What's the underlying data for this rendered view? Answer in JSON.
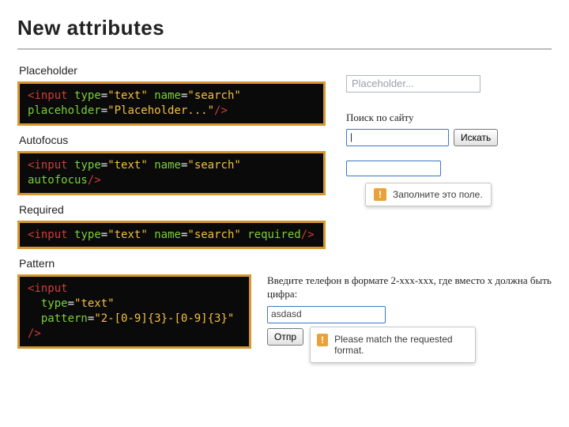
{
  "title": "New attributes",
  "sections": {
    "placeholder": {
      "label": "Placeholder",
      "code": {
        "lt1": "<",
        "tag1": "input",
        "sp1": " ",
        "attr1": "type",
        "eq1": "=",
        "q1": "\"",
        "val1": "text",
        "q2": "\"",
        "sp2": " ",
        "attr2": "name",
        "eq2": "=",
        "q3": "\"",
        "val2": "search",
        "q4": "\"",
        "br": "",
        "attr3": "placeholder",
        "eq3": "=",
        "q5": "\"",
        "val3": "Placeholder...",
        "q6": "\"",
        "slash": "/>",
        "close": ""
      },
      "demo_placeholder": "Placeholder..."
    },
    "autofocus": {
      "label": "Autofocus",
      "code": {
        "lt": "<",
        "tag": "input",
        "sp1": " ",
        "attr1": "type",
        "eq1": "=",
        "q1": "\"",
        "val1": "text",
        "q2": "\"",
        "sp2": " ",
        "attr2": "name",
        "eq2": "=",
        "q3": "\"",
        "val2": "search",
        "q4": "\"",
        "sp3": " ",
        "attr3": "autofocus",
        "slash": "/>"
      },
      "demo_label": "Поиск по сайту",
      "demo_caret": "|",
      "demo_button": "Искать"
    },
    "required": {
      "label": "Required",
      "code": {
        "lt": "<",
        "tag": "input",
        "sp1": " ",
        "attr1": "type",
        "eq1": "=",
        "q1": "\"",
        "val1": "text",
        "q2": "\"",
        "sp2": " ",
        "attr2": "name",
        "eq2": "=",
        "q3": "\"",
        "val2": "search",
        "q4": "\"",
        "sp3": " ",
        "attr3": "required",
        "slash": "/>"
      },
      "tooltip_icon": "!",
      "tooltip_text": "Заполните это поле."
    },
    "pattern": {
      "label": "Pattern",
      "code": {
        "lt": "<",
        "tag": "input",
        "attr1": "type",
        "eq1": "=",
        "q1": "\"",
        "val1": "text",
        "q2": "\"",
        "attr2": "pattern",
        "eq2": "=",
        "q3": "\"",
        "val2": "2-[0-9]{3}-[0-9]{3}",
        "q4": "\"",
        "slash": "/>"
      },
      "demo_prompt": "Введите телефон в формате 2-xxx-xxx, где вместо x должна быть цифра:",
      "demo_value": "asdasd",
      "demo_submit": "Отпр",
      "tooltip_icon": "!",
      "tooltip_text": "Please match the requested format."
    }
  }
}
